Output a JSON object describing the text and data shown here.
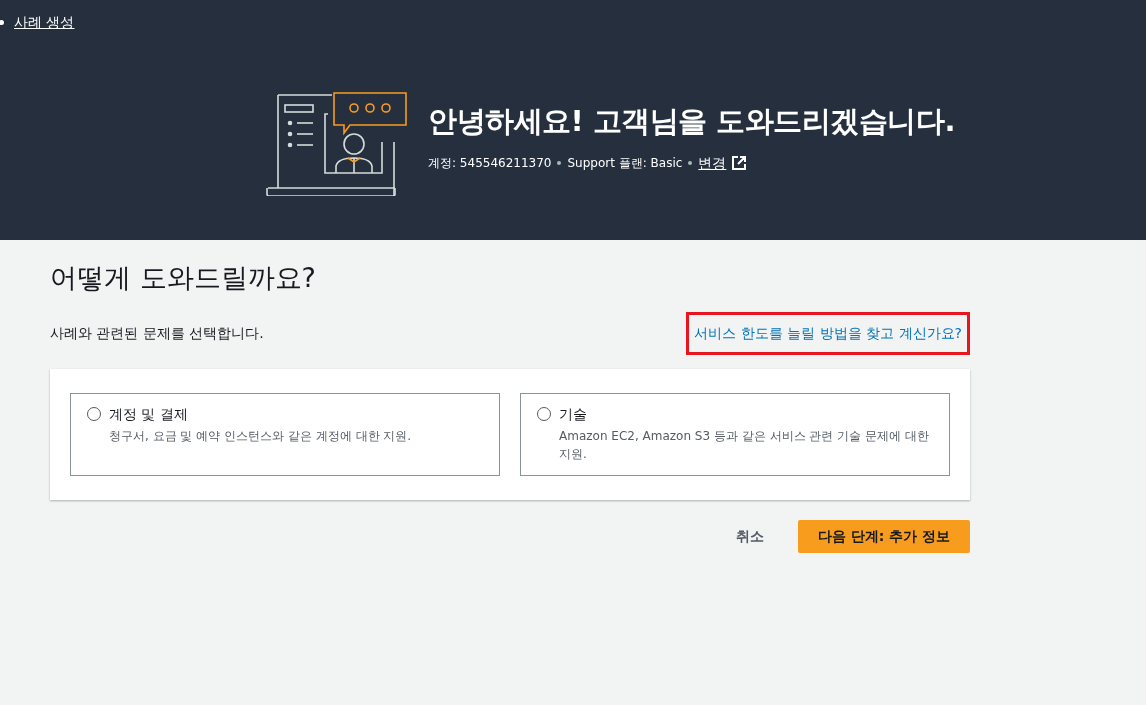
{
  "breadcrumb": {
    "label": "사례 생성"
  },
  "hero": {
    "title": "안녕하세요! 고객님을 도와드리겠습니다.",
    "account": "계정: 545546211370",
    "plan": "Support 플랜: Basic",
    "change_link": "변경"
  },
  "heading": "어떻게 도와드릴까요?",
  "instruction": "사례와 관련된 문제를 선택합니다.",
  "limit_link": {
    "label": "서비스 한도를 늘릴 방법을 찾고 계신가요?",
    "highlighted": true
  },
  "options": [
    {
      "title": "계정 및 결제",
      "description": "청구서, 요금 및 예약 인스턴스와 같은 계정에 대한 지원.",
      "selected": false
    },
    {
      "title": "기술",
      "description": "Amazon EC2, Amazon S3 등과 같은 서비스 관련 기술 문제에 대한 지원.",
      "selected": false
    }
  ],
  "buttons": {
    "cancel": "취소",
    "next": "다음 단계: 추가 정보"
  }
}
